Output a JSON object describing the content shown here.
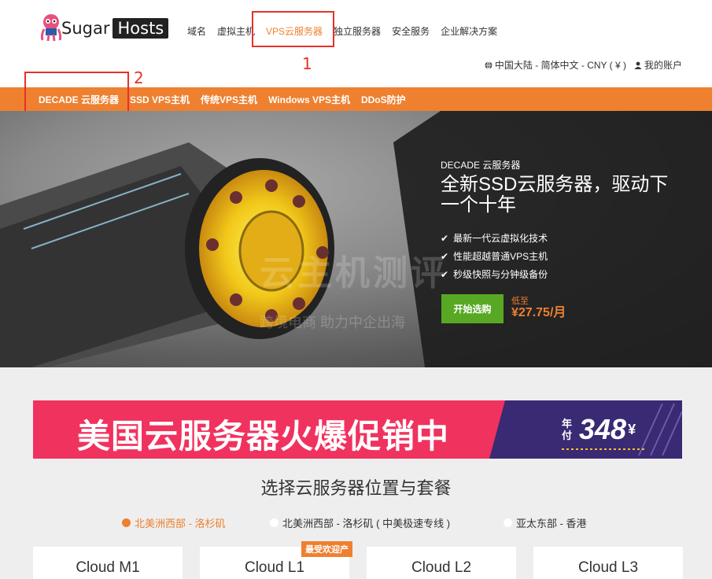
{
  "header": {
    "logo_text_a": "Sugar",
    "logo_text_b": "Hosts",
    "nav": [
      {
        "label": "域名",
        "active": false
      },
      {
        "label": "虚拟主机",
        "active": false
      },
      {
        "label": "VPS云服务器",
        "active": true
      },
      {
        "label": "独立服务器",
        "active": false
      },
      {
        "label": "安全服务",
        "active": false
      },
      {
        "label": "企业解决方案",
        "active": false
      }
    ],
    "region": "中国大陆 - 简体中文 - CNY ( ¥ )",
    "account": "我的账户"
  },
  "annotations": {
    "callout_1": "1",
    "callout_2": "2"
  },
  "subnav": [
    {
      "label": "DECADE 云服务器"
    },
    {
      "label": "SSD VPS主机"
    },
    {
      "label": "传统VPS主机"
    },
    {
      "label": "Windows VPS主机"
    },
    {
      "label": "DDoS防护"
    }
  ],
  "hero": {
    "subtitle": "DECADE 云服务器",
    "title": "全新SSD云服务器，驱动下一个十年",
    "features": [
      "最新一代云虚拟化技术",
      "性能超越普通VPS主机",
      "秒级快照与分钟级备份"
    ],
    "cta": "开始选购",
    "price_low": "低至",
    "price": "¥27.75/月",
    "watermark": "云主机测评",
    "watermark2": "跨境电商 助力中企出海"
  },
  "promo": {
    "text": "美国云服务器火爆促销中",
    "price_label": "年付",
    "price_value": "348",
    "price_unit": "¥"
  },
  "section": {
    "title": "选择云服务器位置与套餐",
    "locations": [
      {
        "label": "北美洲西部 - 洛杉矶",
        "active": true
      },
      {
        "label": "北美洲西部 - 洛杉矶 ( 中美极速专线 )",
        "active": false
      },
      {
        "label": "亚太东部 - 香港",
        "active": false
      }
    ],
    "plans": [
      {
        "name": "Cloud M1",
        "badge": ""
      },
      {
        "name": "Cloud L1",
        "badge": "最受欢迎产"
      },
      {
        "name": "Cloud L2",
        "badge": ""
      },
      {
        "name": "Cloud L3",
        "badge": ""
      }
    ]
  },
  "colors": {
    "accent": "#ee8030",
    "callout": "#e8302a",
    "cta_green": "#58a823",
    "promo_pink": "#f0325f",
    "promo_purple": "#3a2a73"
  }
}
